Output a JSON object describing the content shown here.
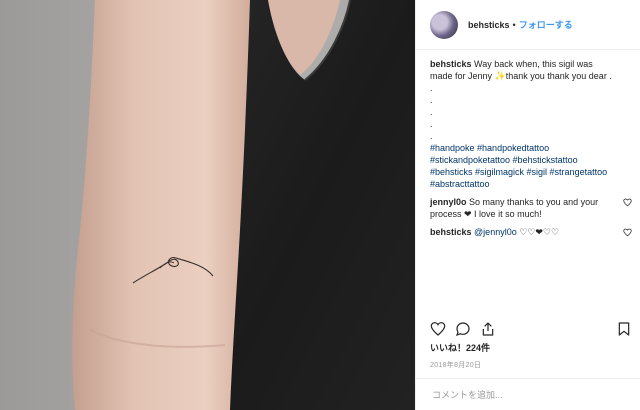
{
  "post": {
    "username": "behsticks",
    "separator": "•",
    "follow_label": "フォローする"
  },
  "caption": {
    "username": "behsticks",
    "text": "Way back when, this sigil was made for Jenny ✨thank you thank you dear .",
    "dots": [
      ".",
      ".",
      ".",
      ".",
      "."
    ],
    "hashtags": [
      "#handpoke #handpokedtattoo",
      "#stickandpoketattoo #behstickstattoo",
      "#behsticks #sigilmagick #sigil #strangetattoo",
      "#abstracttattoo"
    ]
  },
  "comments": [
    {
      "username": "jennyl0o",
      "text": "So many thanks to you and your process ❤ I love it so much!",
      "mention": ""
    },
    {
      "username": "behsticks",
      "mention": "@jennyl0o",
      "text": "♡♡❤♡♡"
    }
  ],
  "actions": {
    "like_icon": "heart-outline-icon",
    "comment_icon": "speech-bubble-icon",
    "share_icon": "share-icon",
    "save_icon": "bookmark-icon"
  },
  "likes_label": "いいね！224件",
  "date": "2018年8月20日",
  "add_comment_placeholder": "コメントを追加...",
  "colors": {
    "link": "#3897f0",
    "hashtag": "#003569",
    "muted": "#999999",
    "border": "#efefef"
  }
}
